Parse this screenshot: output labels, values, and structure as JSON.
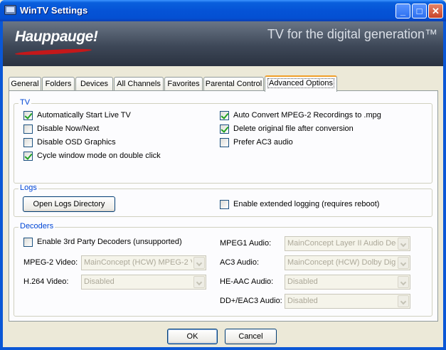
{
  "window": {
    "title": "WinTV Settings"
  },
  "title_buttons": {
    "minimize": "_",
    "maximize": "□",
    "close": "✕"
  },
  "banner": {
    "logo": "Hauppauge!",
    "tagline": "TV for the digital generation™"
  },
  "tabs": [
    {
      "label": "General",
      "active": false
    },
    {
      "label": "Folders",
      "active": false
    },
    {
      "label": "Devices",
      "active": false
    },
    {
      "label": "All Channels",
      "active": false
    },
    {
      "label": "Favorites",
      "active": false
    },
    {
      "label": "Parental Control",
      "active": false
    },
    {
      "label": "Advanced Options",
      "active": true
    }
  ],
  "tv_group": {
    "label": "TV",
    "options": [
      {
        "label": "Automatically Start Live TV",
        "checked": true
      },
      {
        "label": "Disable Now/Next",
        "checked": false
      },
      {
        "label": "Disable OSD Graphics",
        "checked": false
      },
      {
        "label": "Cycle window mode on double click",
        "checked": true
      },
      {
        "label": "Auto Convert MPEG-2 Recordings to .mpg",
        "checked": true
      },
      {
        "label": "Delete original file after conversion",
        "checked": true
      },
      {
        "label": "Prefer AC3 audio",
        "checked": false
      }
    ]
  },
  "logs_group": {
    "label": "Logs",
    "open_button": "Open Logs Directory",
    "extended_logging": {
      "label": "Enable extended logging (requires reboot)",
      "checked": false
    }
  },
  "decoders_group": {
    "label": "Decoders",
    "third_party": {
      "label": "Enable 3rd Party Decoders (unsupported)",
      "checked": false
    },
    "mpeg2_video": {
      "label": "MPEG-2 Video:",
      "value": "MainConcept (HCW) MPEG-2 V"
    },
    "h264_video": {
      "label": "H.264 Video:",
      "value": "Disabled"
    },
    "mpeg1_audio": {
      "label": "MPEG1 Audio:",
      "value": "MainConcept Layer II Audio Dec"
    },
    "ac3_audio": {
      "label": "AC3 Audio:",
      "value": "MainConcept (HCW) Dolby Digit"
    },
    "he_aac_audio": {
      "label": "HE-AAC Audio:",
      "value": "Disabled"
    },
    "dd_eac3_audio": {
      "label": "DD+/EAC3 Audio:",
      "value": "Disabled"
    }
  },
  "footer": {
    "ok": "OK",
    "cancel": "Cancel"
  }
}
